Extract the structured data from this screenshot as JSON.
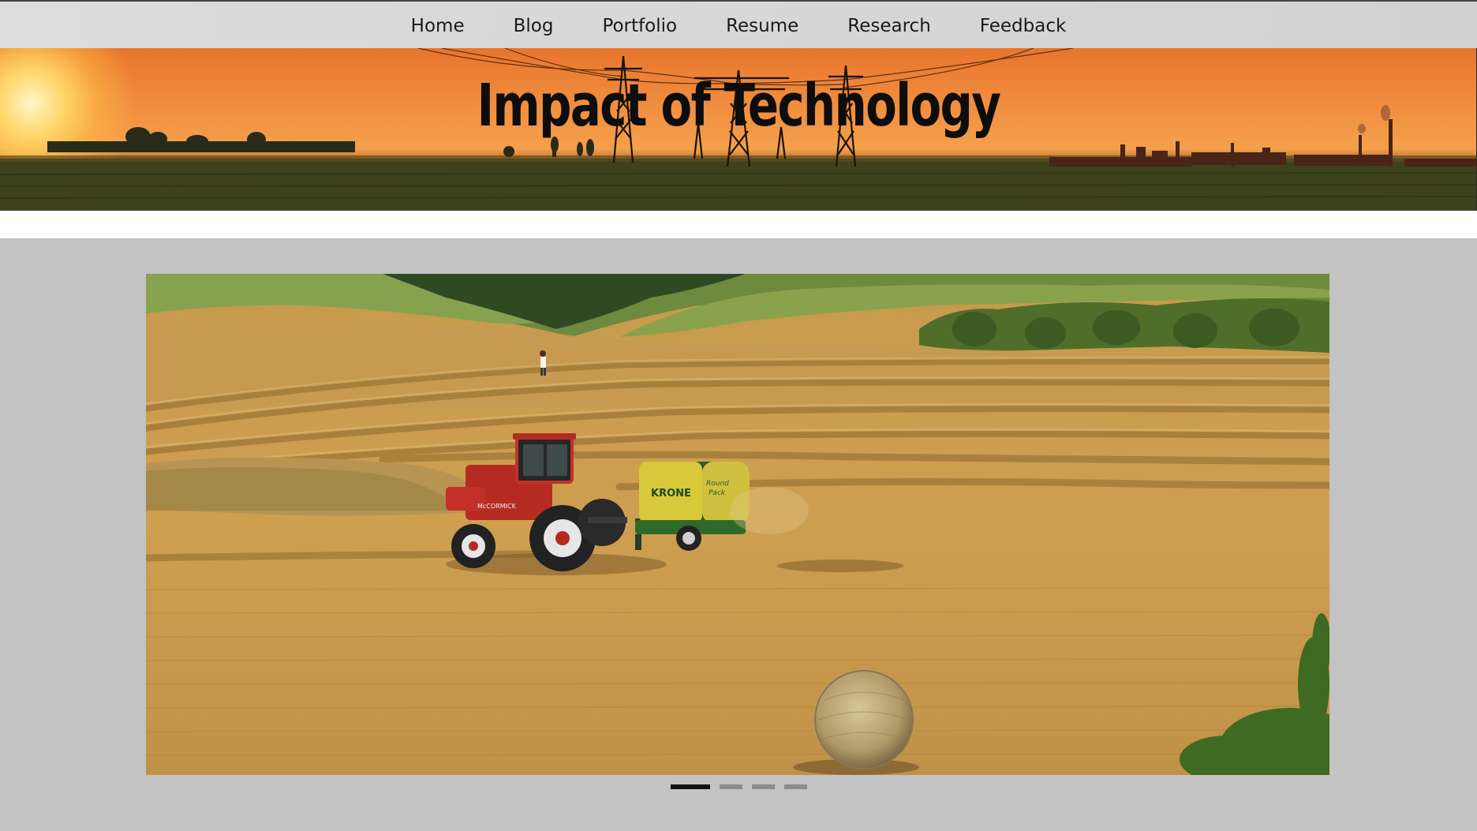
{
  "nav": {
    "items": [
      {
        "label": "Home"
      },
      {
        "label": "Blog"
      },
      {
        "label": "Portfolio"
      },
      {
        "label": "Resume"
      },
      {
        "label": "Research"
      },
      {
        "label": "Feedback"
      }
    ]
  },
  "hero": {
    "title": "Impact of Technology"
  },
  "carousel": {
    "slide_count": 4,
    "active_index": 0,
    "tractor_brand": "McCORMICK",
    "baler_brand": "KRONE",
    "baler_model": "Round Pack"
  },
  "colors": {
    "nav_bg": "#d8d8d8",
    "content_bg": "#c3c3c3",
    "hero_sky": "#ef8a3c",
    "indicator_active": "#111111",
    "indicator_inactive": "#8c8c8c"
  }
}
